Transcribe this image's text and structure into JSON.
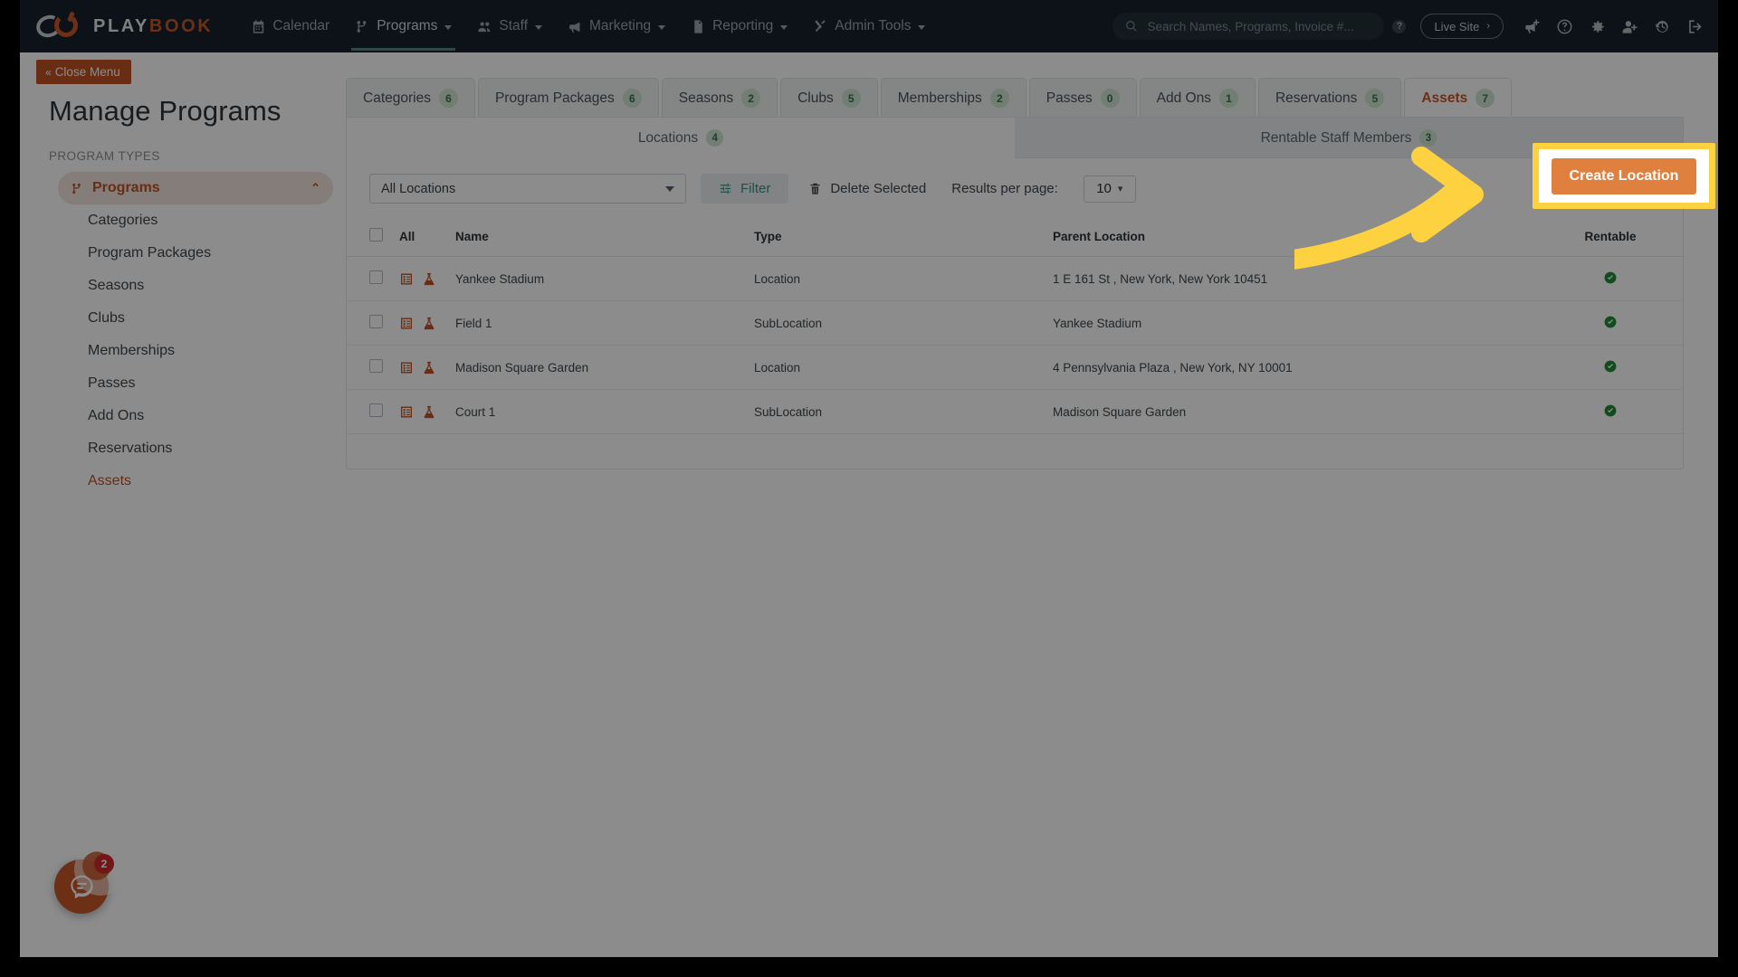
{
  "brand": {
    "word1": "PLAY",
    "word2": "BOOK",
    "logo_icon": "playbook-logo-icon"
  },
  "topnav": {
    "items": [
      {
        "label": "Calendar",
        "icon": "calendar-icon",
        "caret": false,
        "active": false
      },
      {
        "label": "Programs",
        "icon": "programs-branch-icon",
        "caret": true,
        "active": true
      },
      {
        "label": "Staff",
        "icon": "staff-people-icon",
        "caret": true,
        "active": false
      },
      {
        "label": "Marketing",
        "icon": "megaphone-icon",
        "caret": true,
        "active": false
      },
      {
        "label": "Reporting",
        "icon": "document-icon",
        "caret": true,
        "active": false
      },
      {
        "label": "Admin Tools",
        "icon": "tools-icon",
        "caret": true,
        "active": false
      }
    ],
    "search": {
      "placeholder": "Search Names, Programs, Invoice #...",
      "icon": "search-icon"
    },
    "help_badge": "?",
    "live_site": {
      "label": "Live Site",
      "chevron": "›"
    },
    "action_icons": [
      "announcement-add-icon",
      "help-circle-icon",
      "gear-icon",
      "add-user-icon",
      "history-clock-icon",
      "logout-icon"
    ]
  },
  "sidebar": {
    "close_menu": {
      "label": "Close Menu",
      "chevrons": "«"
    },
    "title": "Manage Programs",
    "section_label": "PROGRAM TYPES",
    "group": {
      "label": "Programs",
      "icon": "programs-branch-icon",
      "chevron": "⌃"
    },
    "items": [
      {
        "label": "Categories",
        "active": false
      },
      {
        "label": "Program Packages",
        "active": false
      },
      {
        "label": "Seasons",
        "active": false
      },
      {
        "label": "Clubs",
        "active": false
      },
      {
        "label": "Memberships",
        "active": false
      },
      {
        "label": "Passes",
        "active": false
      },
      {
        "label": "Add Ons",
        "active": false
      },
      {
        "label": "Reservations",
        "active": false
      },
      {
        "label": "Assets",
        "active": true
      }
    ]
  },
  "main": {
    "tabs": [
      {
        "label": "Categories",
        "count": "6",
        "active": false
      },
      {
        "label": "Program Packages",
        "count": "6",
        "active": false
      },
      {
        "label": "Seasons",
        "count": "2",
        "active": false
      },
      {
        "label": "Clubs",
        "count": "5",
        "active": false
      },
      {
        "label": "Memberships",
        "count": "2",
        "active": false
      },
      {
        "label": "Passes",
        "count": "0",
        "active": false
      },
      {
        "label": "Add Ons",
        "count": "1",
        "active": false
      },
      {
        "label": "Reservations",
        "count": "5",
        "active": false
      },
      {
        "label": "Assets",
        "count": "7",
        "active": true
      }
    ],
    "subtabs": [
      {
        "label": "Locations",
        "count": "4",
        "active": true
      },
      {
        "label": "Rentable Staff Members",
        "count": "3",
        "active": false
      }
    ],
    "toolbar": {
      "location_filter_value": "All Locations",
      "filter_label": "Filter",
      "filter_icon": "filter-sliders-icon",
      "delete_selected_label": "Delete Selected",
      "delete_icon": "trash-icon",
      "results_per_page_label": "Results per page:",
      "results_per_page_value": "10"
    },
    "create_button": {
      "label": "Create Location"
    },
    "table": {
      "columns": [
        "",
        "All",
        "Name",
        "Type",
        "Parent Location",
        "Rentable"
      ],
      "rows": [
        {
          "name": "Yankee Stadium",
          "type": "Location",
          "parent": "1 E 161 St , New York, New York 10451",
          "rentable": true,
          "icons": [
            "form-list-icon",
            "flask-icon"
          ]
        },
        {
          "name": "Field 1",
          "type": "SubLocation",
          "parent": "Yankee Stadium",
          "rentable": true,
          "icons": [
            "form-list-icon",
            "flask-icon"
          ]
        },
        {
          "name": "Madison Square Garden",
          "type": "Location",
          "parent": "4 Pennsylvania Plaza , New York, NY 10001",
          "rentable": true,
          "icons": [
            "form-list-icon",
            "flask-icon"
          ]
        },
        {
          "name": "Court 1",
          "type": "SubLocation",
          "parent": "Madison Square Garden",
          "rentable": true,
          "icons": [
            "form-list-icon",
            "flask-icon"
          ]
        }
      ]
    }
  },
  "chat_widget": {
    "badge": "2",
    "icon": "chat-bubble-icon"
  },
  "colors": {
    "brand_orange": "#c8572b",
    "nav_dark": "#16222a",
    "highlight_yellow": "#fdd13f",
    "create_button": "#e0803f",
    "badge_green_bg": "#cfe3d4",
    "badge_green_text": "#3e6f4d",
    "teal_accent": "#3b8f86",
    "rentable_green": "#1f8a35"
  }
}
